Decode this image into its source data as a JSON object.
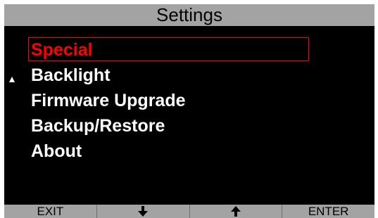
{
  "title": "Settings",
  "menu": {
    "items": [
      {
        "label": "Special",
        "selected": true
      },
      {
        "label": "Backlight",
        "selected": false
      },
      {
        "label": "Firmware Upgrade",
        "selected": false
      },
      {
        "label": "Backup/Restore",
        "selected": false
      },
      {
        "label": "About",
        "selected": false
      }
    ],
    "scroll_marker_icon": "triangle-up-icon"
  },
  "softkeys": [
    {
      "label": "EXIT",
      "icon": null
    },
    {
      "label": "",
      "icon": "arrow-down-icon"
    },
    {
      "label": "",
      "icon": "arrow-up-icon"
    },
    {
      "label": "ENTER",
      "icon": null
    }
  ],
  "colors": {
    "bar_gray": "#a3a3a3",
    "background": "#000000",
    "selection_red": "#ff0000",
    "text_white": "#ffffff"
  }
}
